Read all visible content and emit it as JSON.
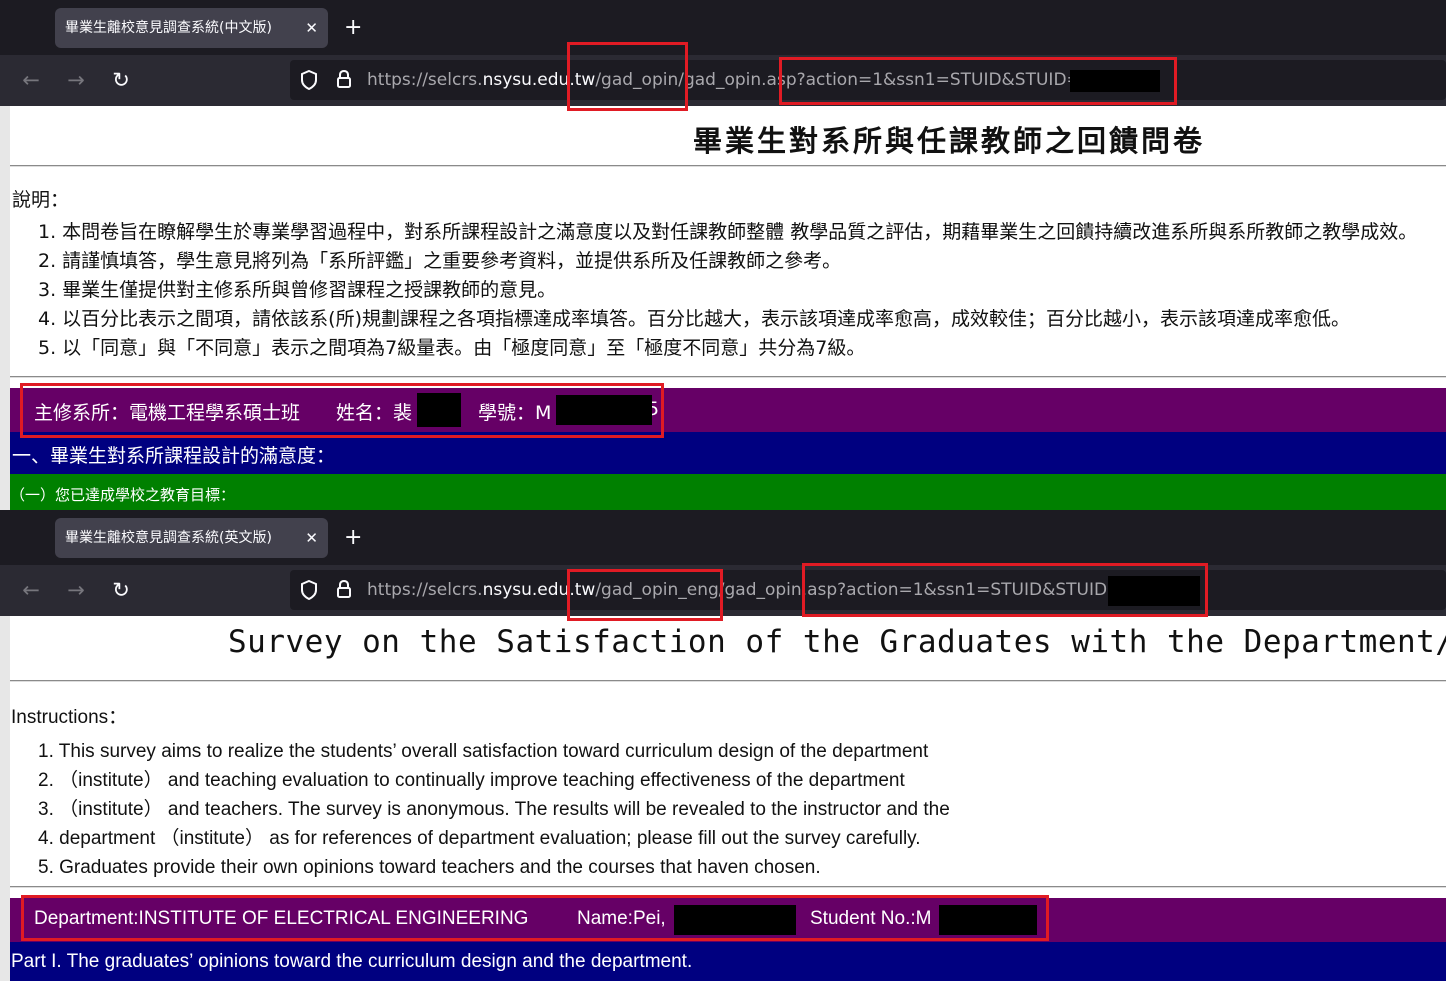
{
  "cn": {
    "tab_title": "畢業生離校意見調查系統(中文版)",
    "tab_close": "✕",
    "new_tab": "+",
    "url_prefix": "https://selcrs.",
    "url_host": "nsysu.edu.tw",
    "url_path": "/gad_opin/gad_opin.asp?action=1&ssn1=STUID&STUID=M",
    "page_title": "畢業生對系所與任課教師之回饋問卷",
    "instructions_label": "說明：",
    "instructions": [
      "1. 本問卷旨在瞭解學生於專業學習過程中，對系所課程設計之滿意度以及對任課教師整體 教學品質之評估，期藉畢業生之回饋持續改進系所與系所教師之教學成效。",
      "2. 請謹慎填答，學生意見將列為「系所評鑑」之重要參考資料，並提供系所及任課教師之參考。",
      "3. 畢業生僅提供對主修系所與曾修習課程之授課教師的意見。",
      "4. 以百分比表示之間項，請依該系(所)規劃課程之各項指標達成率填答。百分比越大，表示該項達成率愈高，成效較佳；百分比越小，表示該項達成率愈低。",
      "5. 以「同意」與「不同意」表示之間項為7級量表。由「極度同意」至「極度不同意」共分為7級。"
    ],
    "info_dept": "主修系所：電機工程學系碩士班",
    "info_name": "姓名：裴",
    "info_id": "學號：M",
    "info_id_tail": "5",
    "section1": "一、畢業生對系所課程設計的滿意度：",
    "subsection1": "（一）您已達成學校之教育目標："
  },
  "en": {
    "tab_title": "畢業生離校意見調查系統(英文版)",
    "tab_close": "✕",
    "new_tab": "+",
    "url_prefix": "https://selcrs.",
    "url_host": "nsysu.edu.tw",
    "url_path": "/gad_opin_eng/gad_opin.asp?action=1&ssn1=STUID&STUID=M",
    "page_title": "Survey on the Satisfaction of the Graduates with the Department/Institute",
    "instructions_label": "Instructions：",
    "instructions": [
      "1. This survey aims to realize the students’ overall satisfaction toward curriculum design of the department",
      "2. （institute） and teaching evaluation to continually improve teaching effectiveness of the department",
      "3. （institute） and teachers. The survey is anonymous. The results will be revealed to the instructor and the",
      "4. department （institute） as for references of department evaluation; please fill out the survey carefully.",
      "5. Graduates provide their own opinions toward teachers and the courses that haven chosen."
    ],
    "info_dept": "Department:INSTITUTE OF ELECTRICAL ENGINEERING",
    "info_name": "Name:Pei,",
    "info_id": "Student No.:M",
    "section1": "Part I. The graduates’ opinions toward the curriculum design and the department."
  },
  "icons": [
    "back-arrow-icon",
    "forward-arrow-icon",
    "reload-icon",
    "shield-icon",
    "lock-icon",
    "close-icon",
    "plus-icon"
  ],
  "colors": {
    "highlight_box": "#e01b24",
    "band_purple": "#660066",
    "band_navy": "#000080",
    "band_green": "#008000",
    "tabbar": "#1c1b22",
    "toolbar": "#2b2a33"
  }
}
